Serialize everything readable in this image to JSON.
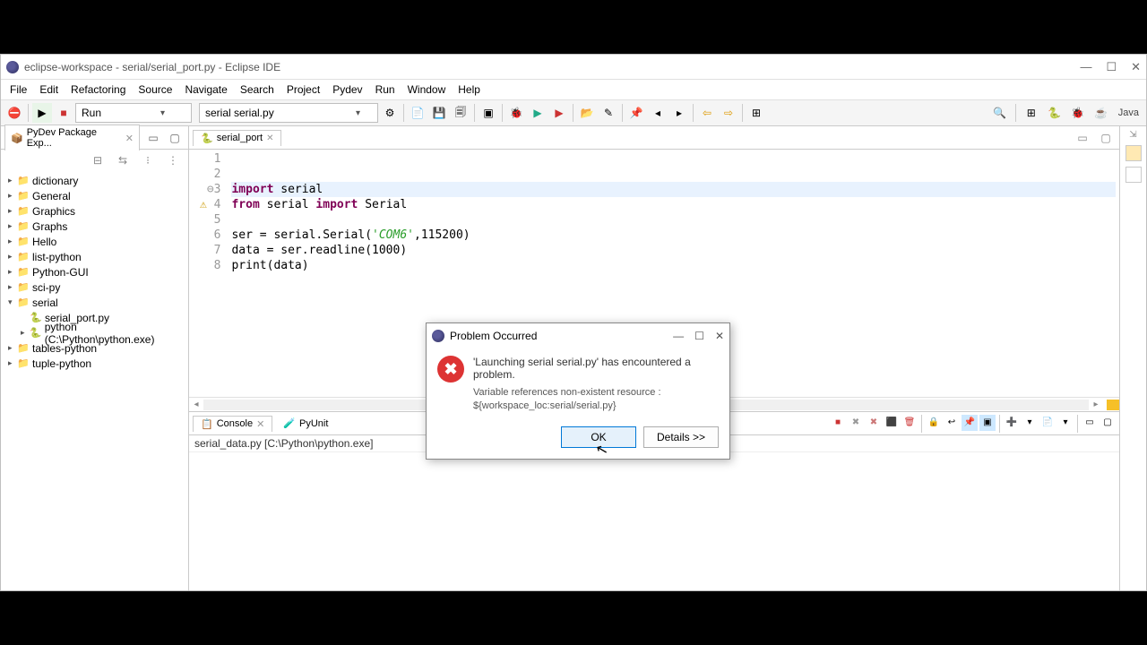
{
  "window": {
    "title": "eclipse-workspace - serial/serial_port.py - Eclipse IDE"
  },
  "menu": [
    "File",
    "Edit",
    "Refactoring",
    "Source",
    "Navigate",
    "Search",
    "Project",
    "Pydev",
    "Run",
    "Window",
    "Help"
  ],
  "toolbar": {
    "run_label": "Run",
    "launch_config": "serial serial.py",
    "perspective": "Java"
  },
  "package_explorer": {
    "title": "PyDev Package Exp...",
    "items": [
      {
        "label": "dictionary",
        "depth": 0,
        "exp": false
      },
      {
        "label": "General",
        "depth": 0,
        "exp": false
      },
      {
        "label": "Graphics",
        "depth": 0,
        "exp": false
      },
      {
        "label": "Graphs",
        "depth": 0,
        "exp": false
      },
      {
        "label": "Hello",
        "depth": 0,
        "exp": false
      },
      {
        "label": "list-python",
        "depth": 0,
        "exp": false
      },
      {
        "label": "Python-GUI",
        "depth": 0,
        "exp": false
      },
      {
        "label": "sci-py",
        "depth": 0,
        "exp": false
      },
      {
        "label": "serial",
        "depth": 0,
        "exp": true
      },
      {
        "label": "serial_port.py",
        "depth": 1,
        "exp": false,
        "file": true
      },
      {
        "label": "python  (C:\\Python\\python.exe)",
        "depth": 1,
        "exp": false
      },
      {
        "label": "tables-python",
        "depth": 0,
        "exp": false
      },
      {
        "label": "tuple-python",
        "depth": 0,
        "exp": false
      }
    ]
  },
  "editor": {
    "tab": "serial_port",
    "lines": [
      {
        "n": "1",
        "html": ""
      },
      {
        "n": "2",
        "html": ""
      },
      {
        "n": "3",
        "html": "<span class='kw'>import</span> serial",
        "hl": true,
        "mark": "⊖"
      },
      {
        "n": "4",
        "html": "<span class='kw'>from</span> serial <span class='kw'>import</span> Serial",
        "warn": true
      },
      {
        "n": "5",
        "html": ""
      },
      {
        "n": "6",
        "html": "ser = serial.Serial(<span class='str'>'COM6'</span>,115200)"
      },
      {
        "n": "7",
        "html": "data = ser.readline(1000)"
      },
      {
        "n": "8",
        "html": "print(data)"
      }
    ]
  },
  "console": {
    "tab1": "Console",
    "tab2": "PyUnit",
    "header": "serial_data.py [C:\\Python\\python.exe]"
  },
  "dialog": {
    "title": "Problem Occurred",
    "message": "'Launching serial serial.py' has encountered a problem.",
    "detail1": "Variable references non-existent resource :",
    "detail2": "${workspace_loc:serial/serial.py}",
    "ok": "OK",
    "details": "Details >>"
  }
}
